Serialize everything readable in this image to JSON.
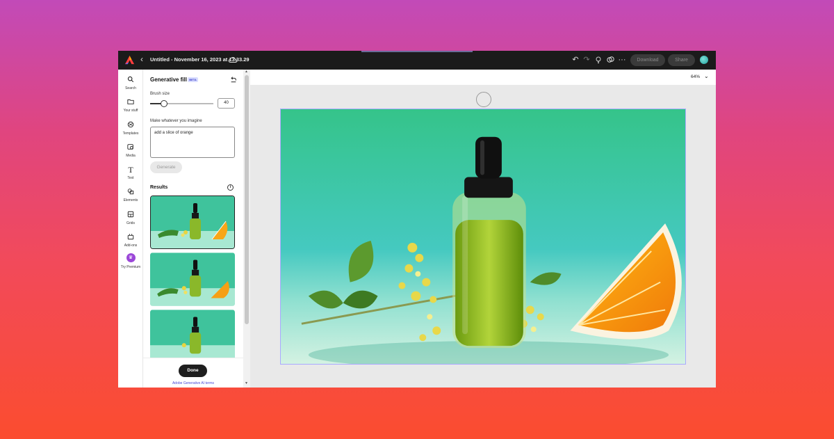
{
  "topbar": {
    "doc_title": "Untitled - November 16, 2023 at 13.33.29",
    "download_label": "Download",
    "share_label": "Share"
  },
  "rail": {
    "items": [
      {
        "label": "Search",
        "icon": "search-icon"
      },
      {
        "label": "Your stuff",
        "icon": "folder-icon"
      },
      {
        "label": "Templates",
        "icon": "templates-icon"
      },
      {
        "label": "Media",
        "icon": "media-icon"
      },
      {
        "label": "Text",
        "icon": "text-icon"
      },
      {
        "label": "Elements",
        "icon": "elements-icon"
      },
      {
        "label": "Grids",
        "icon": "grids-icon"
      },
      {
        "label": "Add-ons",
        "icon": "addons-icon"
      },
      {
        "label": "Try Premium",
        "icon": "crown-icon"
      }
    ]
  },
  "panel": {
    "title": "Generative fill",
    "badge": "BETA",
    "brush_label": "Brush size",
    "brush_value": "40",
    "brush_fraction": 0.22,
    "prompt_label": "Make whatever you imagine",
    "prompt_value": "add a slice of orange",
    "generate_label": "Generate",
    "results_label": "Results",
    "done_label": "Done",
    "terms_label": "Adobe Generative AI terms"
  },
  "canvas": {
    "zoom": "64%"
  },
  "colors": {
    "accent_purple": "#9b47d8",
    "topbar_bg": "#1b1b1b",
    "selection": "#a9a9ff"
  }
}
